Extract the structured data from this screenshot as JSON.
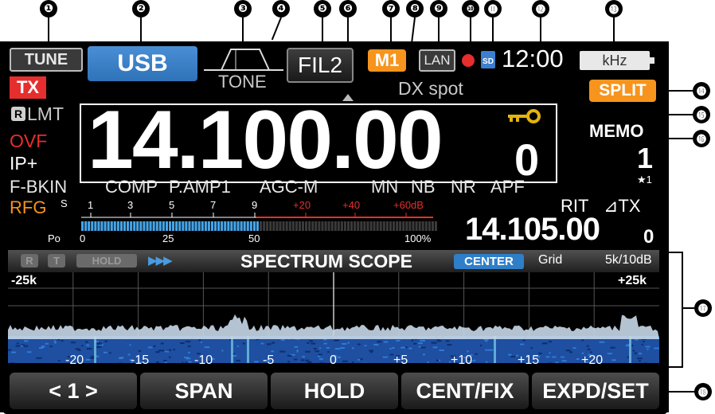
{
  "callouts": [
    "❶",
    "❷",
    "❸",
    "❹",
    "❺",
    "❻",
    "❼",
    "❽",
    "❾",
    "❿",
    "⓫",
    "⓬",
    "⓭",
    "⓮",
    "⓯",
    "⓰",
    "⓱",
    "⓲"
  ],
  "status": {
    "tune": "TUNE",
    "tx": "TX",
    "mode": "USB",
    "tone": "TONE",
    "filter": "FIL2",
    "memory_channel": "M1",
    "dx_spot": "DX spot",
    "lan": "LAN",
    "sd": "SD",
    "time": "12:00",
    "unit": "kHz",
    "split": "SPLIT"
  },
  "left_indicators": {
    "r_badge": "R",
    "lmt": "LMT",
    "ovf": "OVF",
    "ip_plus": "IP+",
    "rfg": "RFG"
  },
  "frequency": {
    "main": "14.100.00",
    "small_digit": "0"
  },
  "memo": {
    "label": "MEMO",
    "channel": "1",
    "star": "★1"
  },
  "functions": [
    "F-BKIN",
    "COMP",
    "P.AMP1",
    "AGC-M",
    "MN",
    "NB",
    "NR",
    "APF"
  ],
  "meter": {
    "s_label": "S",
    "s_ticks": [
      "1",
      "3",
      "5",
      "7",
      "9"
    ],
    "plus_ticks": [
      "+20",
      "+40",
      "+60dB"
    ],
    "po_label": "Po",
    "po_ticks": [
      "0",
      "25",
      "50",
      "100%"
    ],
    "level": 0.5
  },
  "rit": {
    "rit_label": "RIT",
    "tx_label": "⊿TX",
    "frequency": "14.105.00",
    "small_digit": "0"
  },
  "scope": {
    "r": "R",
    "t": "T",
    "hold": "HOLD",
    "arrows": "▶▶▶",
    "title": "SPECTRUM SCOPE",
    "center": "CENTER",
    "grid": "Grid",
    "span_info": "5k/10dB",
    "left_edge": "-25k",
    "right_edge": "+25k",
    "axis": [
      "-20",
      "-15",
      "-10",
      "-5",
      "0",
      "+5",
      "+10",
      "+15",
      "+20"
    ]
  },
  "softkeys": [
    "< 1 >",
    "SPAN",
    "HOLD",
    "CENT/FIX",
    "EXPD/SET"
  ],
  "colors": {
    "mode_blue": "#2e72b8",
    "memory_orange": "#f7941d",
    "tx_red": "#e62e2e",
    "key_yellow": "#e3b30f",
    "meter_blue": "#45a5e8",
    "center_blue": "#2f7fc8"
  }
}
